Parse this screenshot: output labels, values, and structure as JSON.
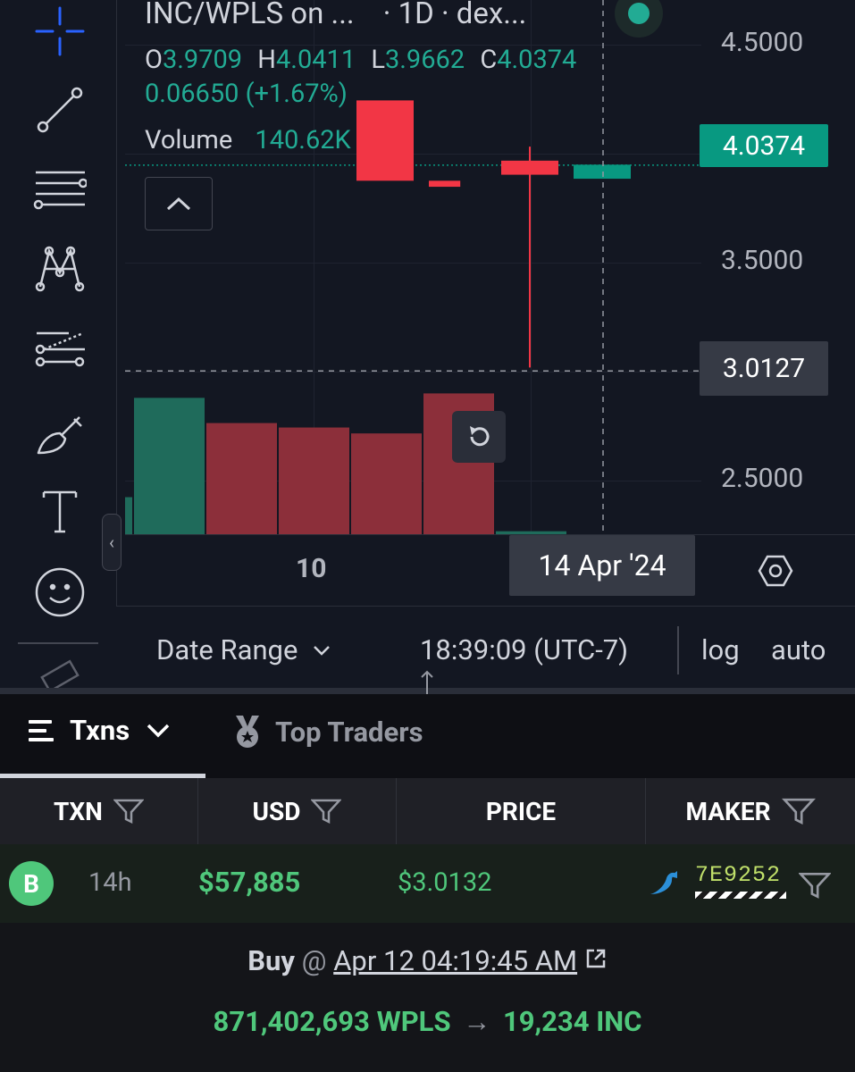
{
  "chart_header": {
    "symbol": "INC/WPLS on ...",
    "interval": "· 1D · dex...",
    "ohlc": {
      "o_label": "O",
      "o_value": "3.9709",
      "h_label": "H",
      "h_value": "4.0411",
      "l_label": "L",
      "l_value": "3.9662",
      "c_label": "C",
      "c_value": "4.0374"
    },
    "change": "0.06650 (+1.67%)",
    "volume_label": "Volume",
    "volume_value": "140.62K"
  },
  "price_axis": {
    "ticks": [
      "4.5000",
      "3.5000",
      "2.5000"
    ],
    "last_price": "4.0374",
    "crosshair_price": "3.0127"
  },
  "time_axis": {
    "tick": "10",
    "crosshair_date": "14 Apr '24"
  },
  "chart_footer": {
    "date_range_label": "Date Range",
    "clock": "18:39:09 (UTC-7)",
    "log_label": "log",
    "auto_label": "auto"
  },
  "chart_data": {
    "type": "candlestick",
    "candles": [
      {
        "open": 4.36,
        "close": 3.96
      },
      {
        "open": 3.96,
        "close": 3.93
      },
      {
        "open": 4.06,
        "close": 3.99,
        "high": 4.13,
        "low": 3.03
      },
      {
        "open": 3.97,
        "close": 4.04
      }
    ],
    "volume": [
      {
        "value": 0.25,
        "dir": "up"
      },
      {
        "value": 0.92,
        "dir": "up"
      },
      {
        "value": 0.75,
        "dir": "down"
      },
      {
        "value": 0.72,
        "dir": "down"
      },
      {
        "value": 0.68,
        "dir": "down"
      },
      {
        "value": 0.95,
        "dir": "down"
      },
      {
        "value": 0.02,
        "dir": "up"
      }
    ],
    "ylim": [
      2.2,
      4.86
    ],
    "last_price": 4.0374,
    "crosshair_price": 3.0127,
    "colors": {
      "up": "#089981",
      "down": "#f23645",
      "up_volume": "#1f6b5b",
      "down_volume": "#8c2f3a"
    }
  },
  "tabs": [
    {
      "label": "Txns"
    },
    {
      "label": "Top Traders"
    }
  ],
  "table": {
    "columns": [
      "TXN",
      "USD",
      "PRICE",
      "MAKER"
    ],
    "row": {
      "type_badge": "B",
      "age": "14h",
      "usd": "$57,885",
      "price": "$3.0132",
      "maker": "7E9252"
    }
  },
  "tx_detail": {
    "action": "Buy",
    "at": "@",
    "datetime": "Apr 12 04:19:45 AM",
    "amount_in": "871,402,693 WPLS",
    "arrow": "→",
    "amount_out": "19,234 INC"
  },
  "colors": {
    "green": "#22ab94",
    "buy_green": "#4fc77b",
    "red": "#f23645",
    "crosshair_blue": "#2962ff"
  }
}
